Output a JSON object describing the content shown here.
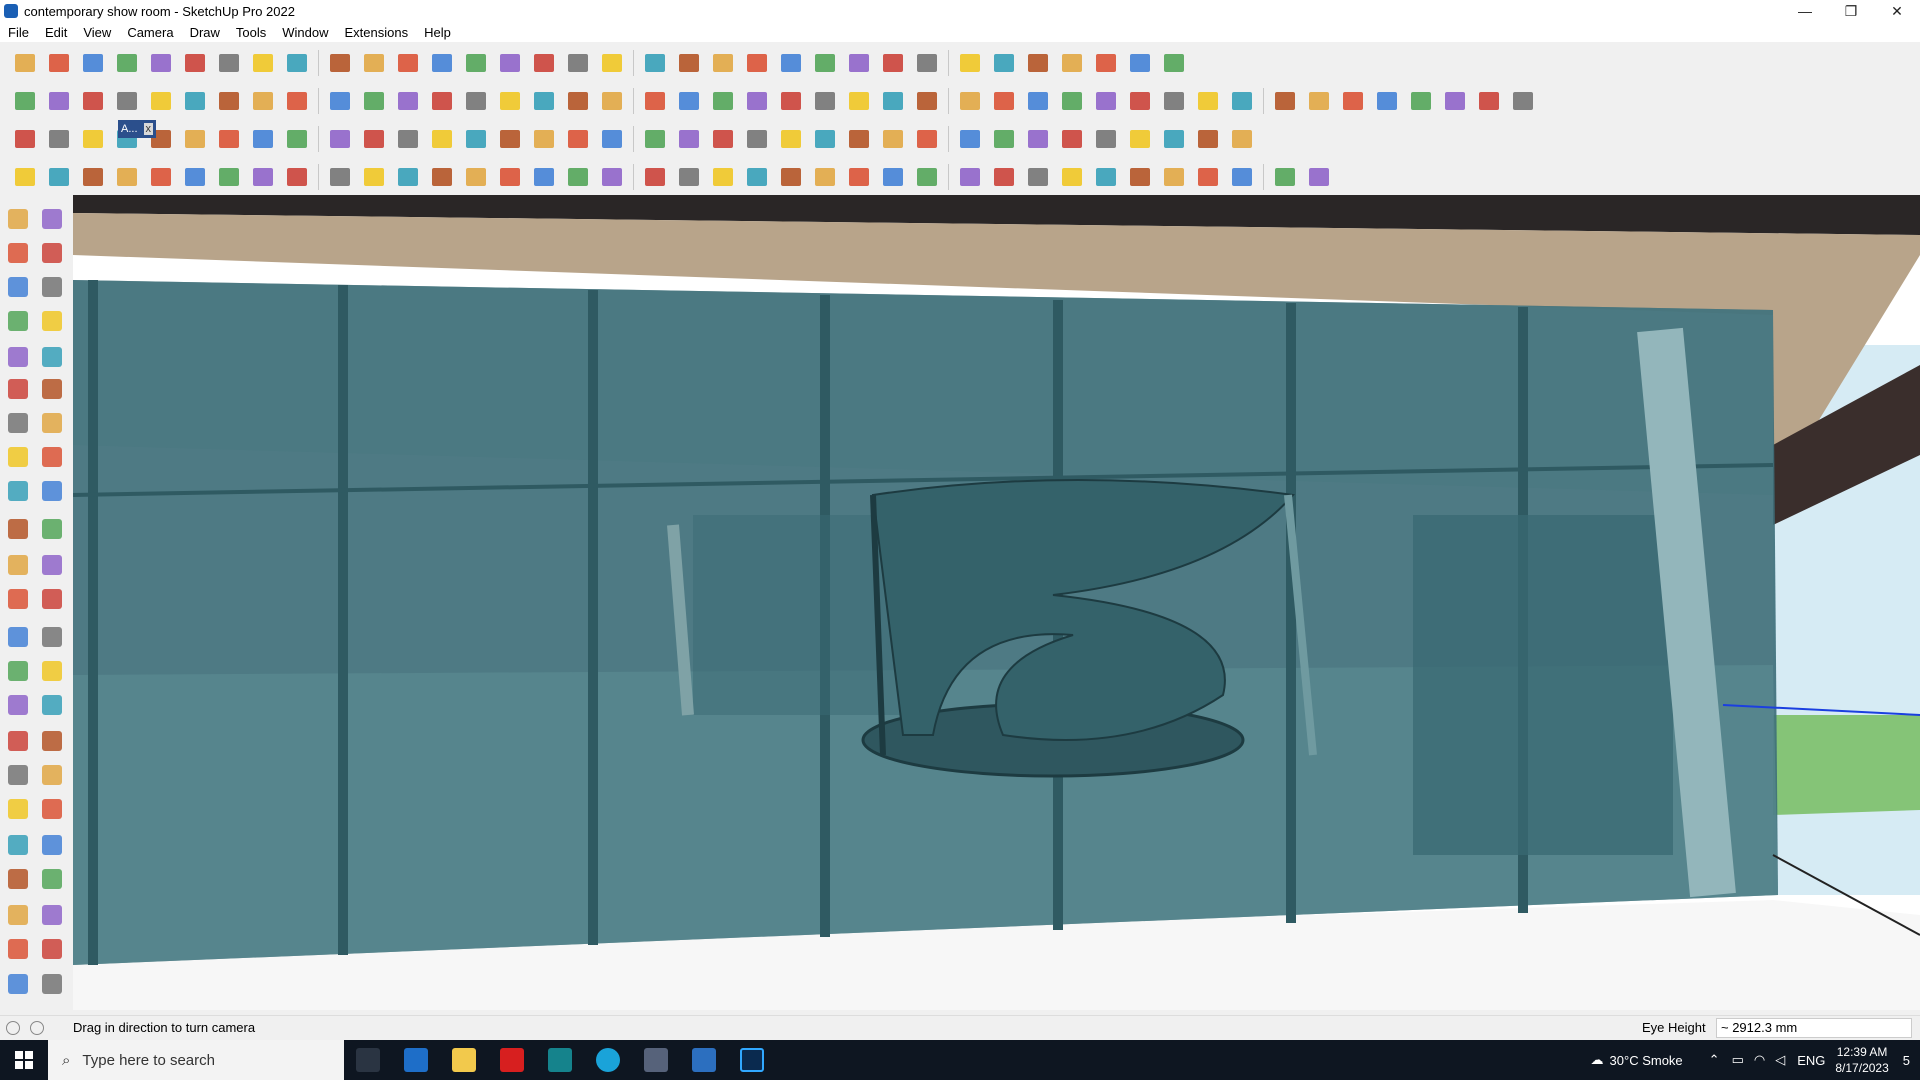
{
  "window": {
    "title": "contemporary show room - SketchUp Pro 2022",
    "controls": {
      "minimize": "—",
      "restore": "❐",
      "close": "✕"
    }
  },
  "menu": [
    "File",
    "Edit",
    "View",
    "Camera",
    "Draw",
    "Tools",
    "Window",
    "Extensions",
    "Help"
  ],
  "toolbar_tab": {
    "label": "A...",
    "close": "x"
  },
  "status": {
    "hint": "Drag in direction to turn camera",
    "measurement_label": "Eye Height",
    "measurement_value": "~ 2912.3 mm"
  },
  "taskbar": {
    "search_placeholder": "Type here to search",
    "weather": "30°C  Smoke",
    "language": "ENG",
    "time": "12:39 AM",
    "date": "8/17/2023",
    "notifications": "5"
  },
  "icons": {
    "toolbar_row1": [
      "zoom-icon",
      "select-icon",
      "eraser-icon",
      "pencil-icon",
      "freehand-icon",
      "rectangle-icon",
      "push-pull-icon",
      "follow-me-icon",
      "move-icon",
      "rotate-icon",
      "scale-icon",
      "tape-measure-icon",
      "text-icon",
      "paint-bucket-icon",
      "orbit-icon",
      "pan-icon",
      "zoom-window-icon",
      "zoom-extents-icon",
      "warehouse-icon",
      "extension-warehouse-icon",
      "layout-icon",
      "style-builder-icon",
      "user-account-icon",
      "component-icon",
      "section-icon",
      "axes-icon",
      "solid-tools-icon",
      "sandbox-icon",
      "scale-tool-icon",
      "flip-icon",
      "undo-icon",
      "redo-icon",
      "info-icon"
    ],
    "colors": {
      "accent_red": "#cc3300",
      "accent_blue": "#1a5fb4",
      "glass": "#3c6e78",
      "sky": "#d7ecf4",
      "grass": "#7fbf6e",
      "taskbar": "#0e1621"
    }
  }
}
